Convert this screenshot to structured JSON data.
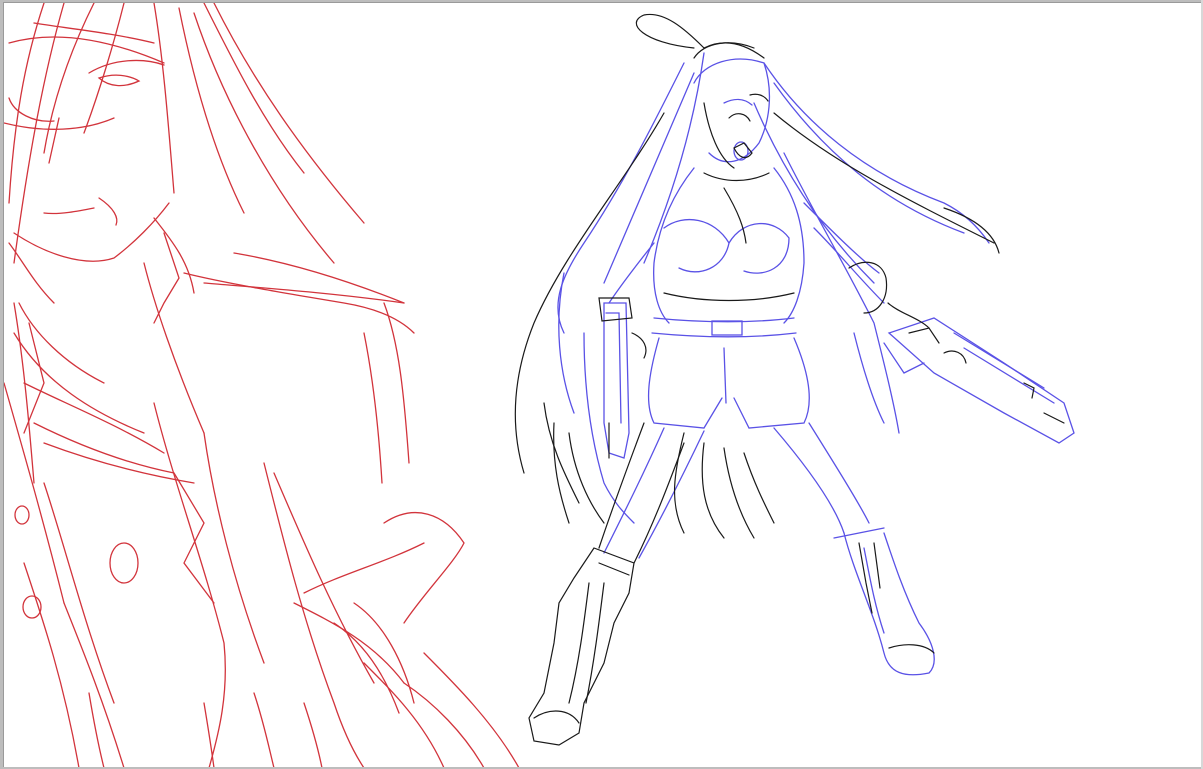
{
  "app": {
    "canvas_background": "#ffffff",
    "frame_color": "#bdbdbd"
  },
  "layers": [
    {
      "name": "red-sketch",
      "color": "#d2343c"
    },
    {
      "name": "blue-sketch",
      "color": "#5a52e6"
    },
    {
      "name": "black-lineart",
      "color": "#1a1a1a"
    }
  ],
  "icons": {
    "canvas": "drawing-canvas"
  }
}
